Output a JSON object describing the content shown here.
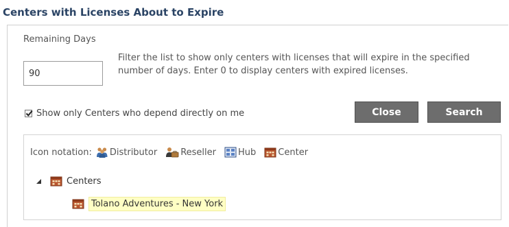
{
  "page": {
    "title": "Centers with Licenses About to Expire"
  },
  "filter": {
    "remaining_days_label": "Remaining Days",
    "remaining_days_value": "90",
    "help_text": "Filter the list to show only centers with licenses that will expire in the specified number of days. Enter 0 to display centers with expired licenses.",
    "show_direct_label": "Show only Centers who depend directly on me",
    "show_direct_checked": true
  },
  "buttons": {
    "close_label": "Close",
    "search_label": "Search"
  },
  "legend": {
    "label": "Icon notation:",
    "items": [
      {
        "label": "Distributor",
        "icon": "distributor-icon"
      },
      {
        "label": "Reseller",
        "icon": "reseller-icon"
      },
      {
        "label": "Hub",
        "icon": "hub-icon"
      },
      {
        "label": "Center",
        "icon": "center-icon"
      }
    ]
  },
  "tree": {
    "root_label": "Centers",
    "root_expanded": true,
    "children": [
      {
        "label": "Tolano Adventures - New York",
        "icon": "center-icon",
        "highlighted": true
      }
    ]
  },
  "colors": {
    "title": "#2b4465",
    "button_bg": "#6d6d6d",
    "highlight_bg": "#ffffc4"
  }
}
